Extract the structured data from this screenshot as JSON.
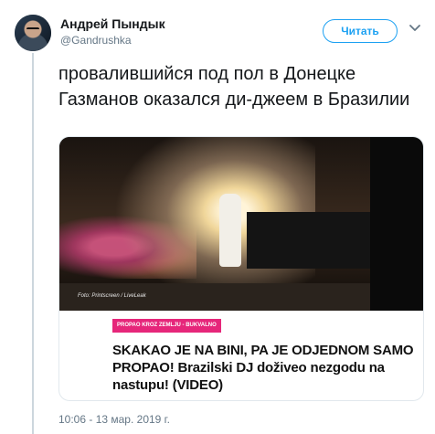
{
  "author": {
    "display_name": "Андрей Пындык",
    "username": "@Gandrushka"
  },
  "follow_button": {
    "label": "Читать"
  },
  "tweet": {
    "text": "провалившийся под пол в Донецке Газманов оказался ди-джеем в Бразилии",
    "timestamp": "10:06 - 13 мар. 2019 г."
  },
  "card": {
    "image_caption": "Foto: Printscreen / LiveLeak",
    "tag": "PROPAO KROZ ZEMLJU - BUKVALNO",
    "headline": "SKAKAO JE NA BINI, PA JE ODJEDNOM SAMO PROPAO! Brazilski DJ doživeo nezgodu na nastupu! (VIDEO)"
  },
  "colors": {
    "accent": "#1da1f2",
    "secondary_text": "#657786",
    "tag_background": "#e6267a",
    "thread_line": "#ccd6dd"
  },
  "icons": {
    "more": "chevron-down-icon",
    "avatar": "user-avatar"
  }
}
